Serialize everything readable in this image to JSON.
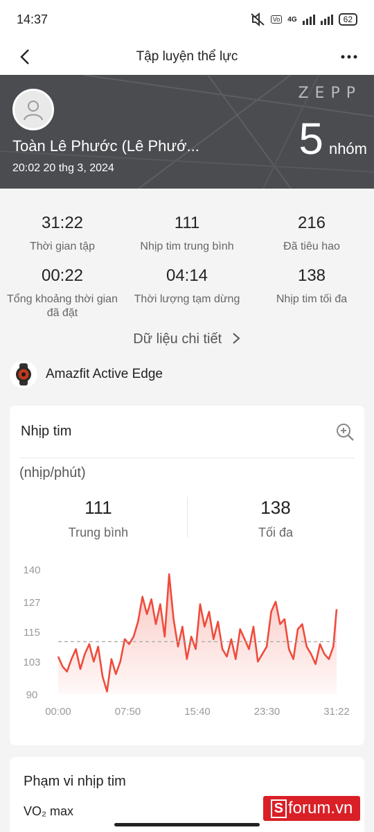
{
  "status": {
    "time": "14:37",
    "battery": "62",
    "network": "4G"
  },
  "appbar": {
    "title": "Tập luyện thể lực",
    "back_icon": "chevron-left-icon",
    "more_icon": "more-horizontal-icon"
  },
  "hero": {
    "user_name": "Toàn Lê Phước (Lê Phướ...",
    "datetime": "20:02 20 thg 3, 2024",
    "brand": "ZEPP",
    "sets_value": "5",
    "sets_unit": "nhóm"
  },
  "stats": [
    {
      "value": "31:22",
      "label": "Thời gian tập"
    },
    {
      "value": "111",
      "label": "Nhịp tim trung bình"
    },
    {
      "value": "216",
      "label": "Đã tiêu hao"
    },
    {
      "value": "00:22",
      "label": "Tổng khoảng thời gian đã đặt"
    },
    {
      "value": "04:14",
      "label": "Thời lượng tạm dừng"
    },
    {
      "value": "138",
      "label": "Nhịp tim tối đa"
    }
  ],
  "detail_link": "Dữ liệu chi tiết",
  "device": {
    "name": "Amazfit Active Edge"
  },
  "heart_card": {
    "title": "Nhịp tim",
    "unit": "(nhịp/phút)",
    "avg_value": "111",
    "avg_label": "Trung bình",
    "max_value": "138",
    "max_label": "Tối đa"
  },
  "chart_data": {
    "type": "area",
    "ylim": [
      90,
      140
    ],
    "y_ticks": [
      "140",
      "127",
      "115",
      "103",
      "90"
    ],
    "x_ticks": [
      "00:00",
      "07:50",
      "15:40",
      "23:30",
      "31:22"
    ],
    "average_line": 111,
    "series": [
      {
        "x_minutes": [
          0,
          0.5,
          1,
          1.5,
          2,
          2.5,
          3,
          3.5,
          4,
          4.5,
          5,
          5.5,
          6,
          6.5,
          7,
          7.5,
          8,
          8.5,
          9,
          9.5,
          10,
          10.5,
          11,
          11.5,
          12,
          12.5,
          13,
          13.5,
          14,
          14.5,
          15,
          15.5,
          16,
          16.5,
          17,
          17.5,
          18,
          18.5,
          19,
          19.5,
          20,
          20.5,
          21,
          21.5,
          22,
          22.5,
          23,
          23.5,
          24,
          24.5,
          25,
          25.5,
          26,
          26.5,
          27,
          27.5,
          28,
          28.5,
          29,
          29.5,
          30,
          30.5,
          31,
          31.37
        ],
        "values": [
          105,
          101,
          99,
          104,
          108,
          100,
          106,
          110,
          103,
          109,
          97,
          91,
          104,
          98,
          103,
          112,
          110,
          113,
          119,
          129,
          122,
          128,
          118,
          126,
          113,
          138,
          120,
          109,
          117,
          104,
          113,
          108,
          126,
          117,
          123,
          112,
          119,
          108,
          105,
          112,
          104,
          116,
          112,
          108,
          117,
          103,
          106,
          109,
          123,
          127,
          118,
          120,
          108,
          104,
          116,
          118,
          109,
          106,
          102,
          110,
          106,
          104,
          109,
          124
        ]
      }
    ]
  },
  "range_card": {
    "title": "Phạm vi nhịp tim",
    "subtitle": "VO₂ max"
  },
  "watermark": "forum.vn"
}
